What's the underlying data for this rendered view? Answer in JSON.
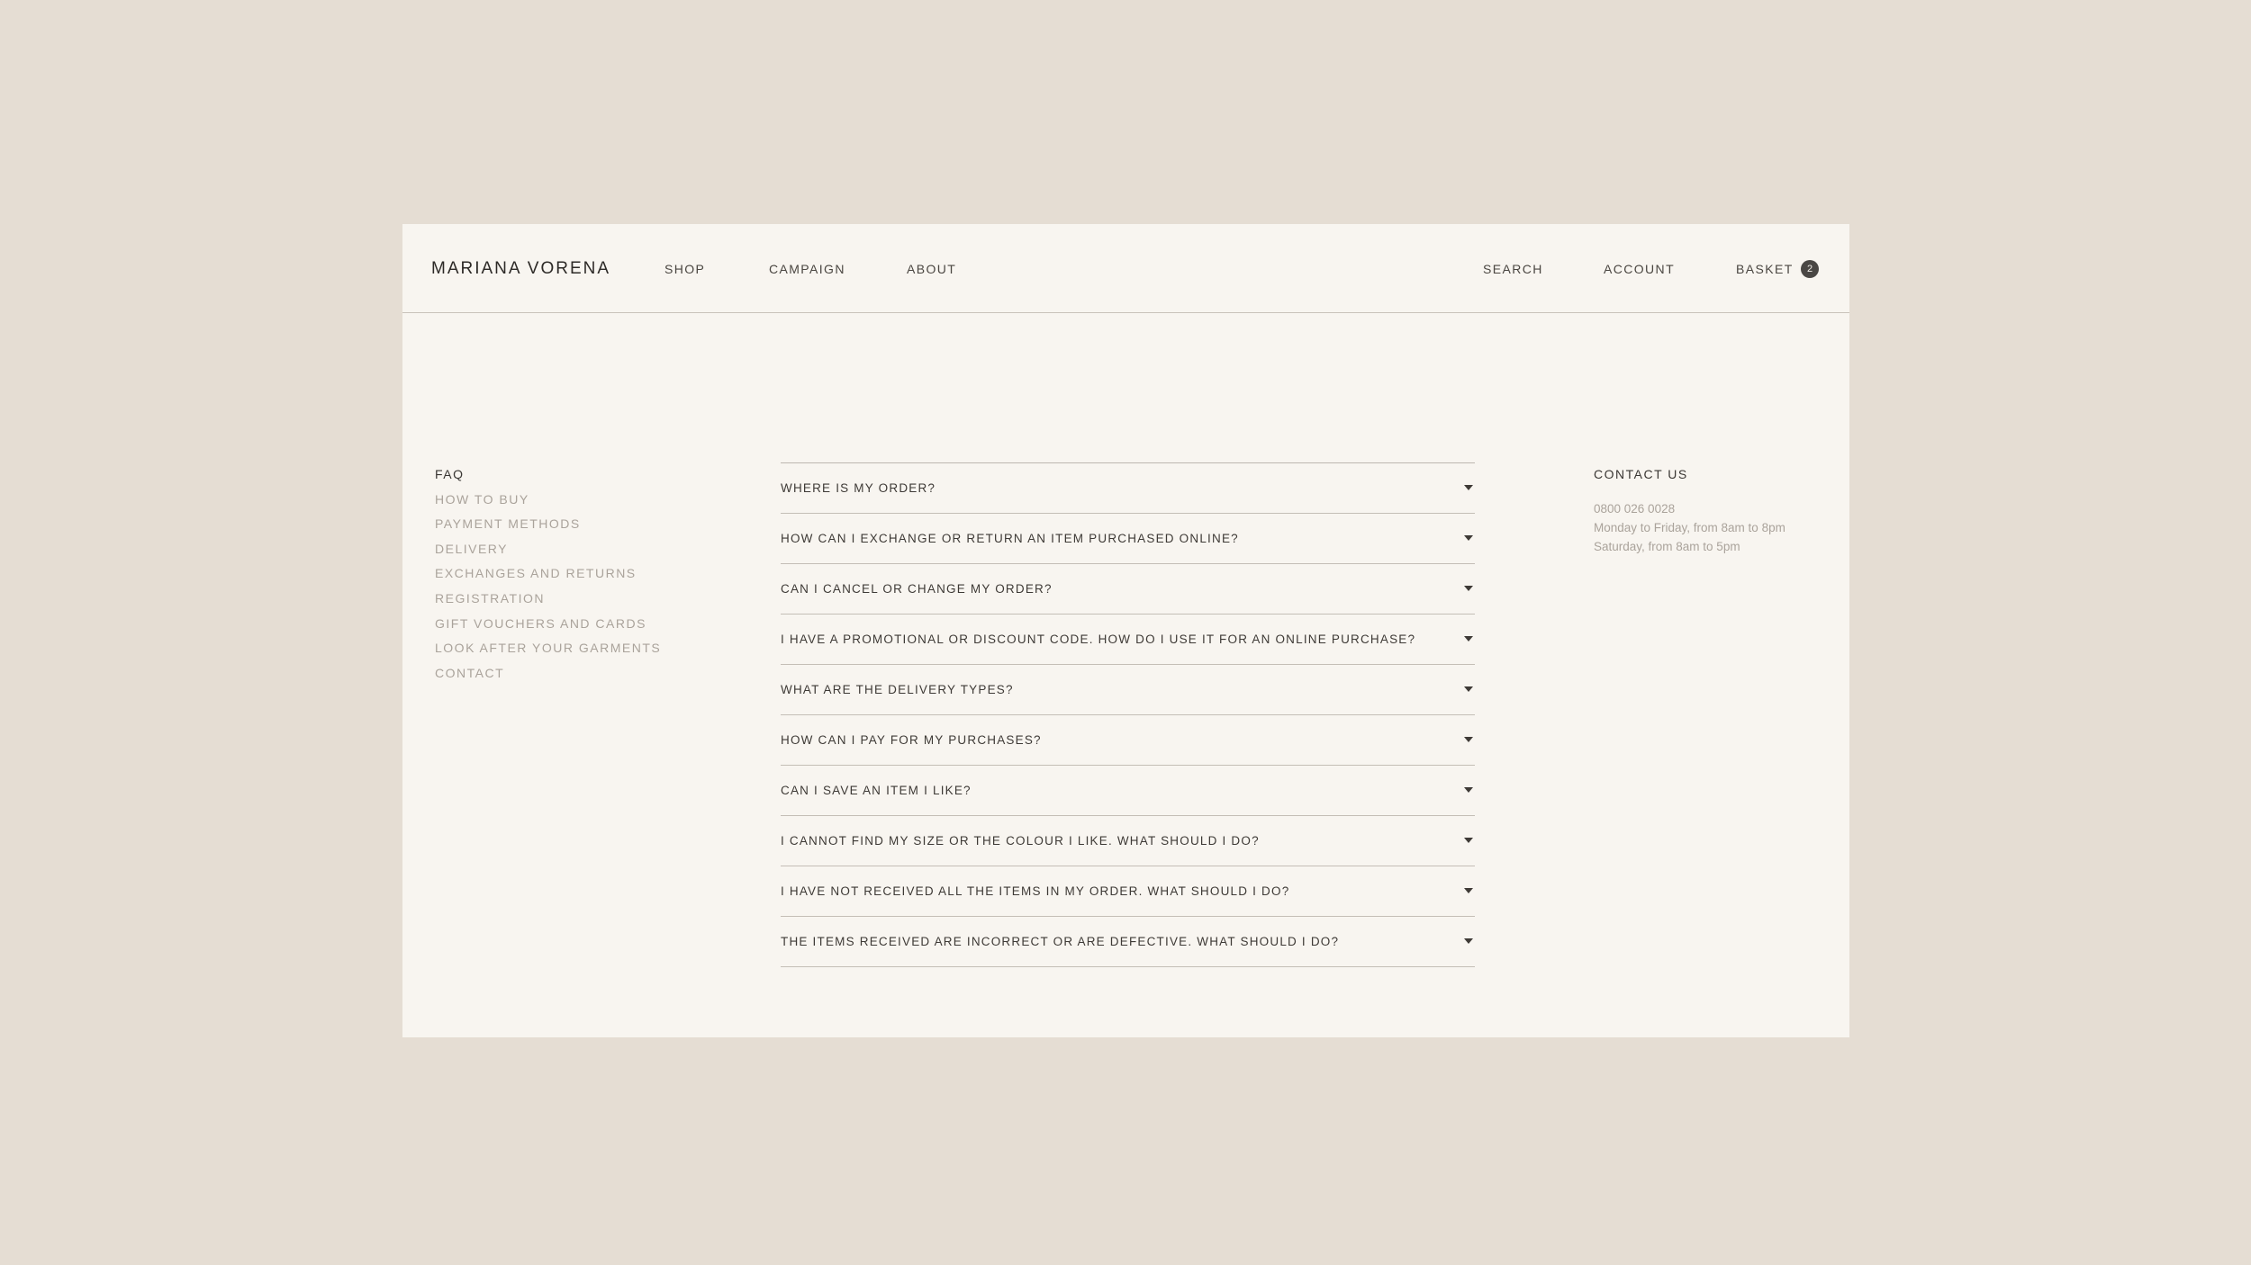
{
  "header": {
    "logo": "MARIANA VORENA",
    "nav": [
      "SHOP",
      "CAMPAIGN",
      "ABOUT"
    ],
    "search": "SEARCH",
    "account": "ACCOUNT",
    "basket": "BASKET",
    "basket_count": "2"
  },
  "sidebar": {
    "items": [
      "FAQ",
      "HOW TO BUY",
      "PAYMENT METHODS",
      "DELIVERY",
      "EXCHANGES AND RETURNS",
      "REGISTRATION",
      "GIFT VOUCHERS AND CARDS",
      "LOOK AFTER YOUR GARMENTS",
      "CONTACT"
    ],
    "active_index": 0
  },
  "faq": {
    "questions": [
      "WHERE IS MY ORDER?",
      "HOW CAN I EXCHANGE OR RETURN AN ITEM PURCHASED ONLINE?",
      "CAN I CANCEL OR CHANGE MY ORDER?",
      "I HAVE A PROMOTIONAL OR DISCOUNT CODE. HOW DO I USE IT FOR AN ONLINE PURCHASE?",
      "WHAT ARE THE DELIVERY TYPES?",
      "HOW CAN I PAY FOR MY PURCHASES?",
      "CAN I SAVE AN ITEM I LIKE?",
      "I CANNOT FIND MY SIZE OR THE COLOUR I LIKE. WHAT SHOULD I DO?",
      "I HAVE NOT RECEIVED ALL THE ITEMS IN MY ORDER. WHAT SHOULD I DO?",
      "THE ITEMS RECEIVED ARE INCORRECT OR ARE DEFECTIVE. WHAT SHOULD I DO?"
    ],
    "expand_icon": "caret-down-icon"
  },
  "contact": {
    "title": "CONTACT US",
    "phone": "0800 026 0028",
    "weekday_hours": "Monday to Friday, from 8am to 8pm",
    "saturday_hours": "Saturday, from 8am to 5pm"
  },
  "colors": {
    "background": "#e5ddd3",
    "panel": "#f8f5f0",
    "text": "#3a3734",
    "muted_text": "#aaa39b",
    "divider": "#c4beb6",
    "badge": "#4a4744"
  }
}
